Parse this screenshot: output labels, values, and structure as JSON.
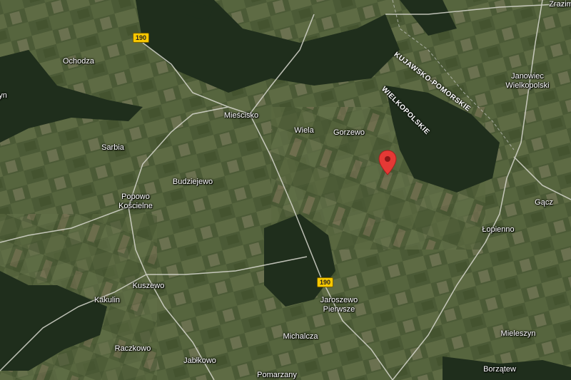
{
  "map": {
    "type": "satellite",
    "road_shields": [
      {
        "id": "r1",
        "label": "190"
      },
      {
        "id": "r2",
        "label": "190"
      }
    ],
    "region_labels": [
      "KUJAWSKO-POMORSKIE",
      "WIELKOPOLSKIE"
    ],
    "places": {
      "zrazim": "Zrazim",
      "ochodza": "Ochodza",
      "yn": "yn",
      "miescisko": "Mieścisko",
      "wiela": "Wiela",
      "gorzewo": "Gorzewo",
      "janowiec": "Janowiec\nWielkopolski",
      "sarbia": "Sarbia",
      "budziejewo": "Budziejewo",
      "popowo": "Popowo\nKościelne",
      "gacz": "Gącz",
      "lopienno": "Łopienno",
      "kuszewo": "Kuszewo",
      "kakulin": "Kakulin",
      "jaroszewo": "Jaroszewo\nPierwsze",
      "michalcza": "Michalcza",
      "raczkowo": "Raczkowo",
      "mieleszyn": "Mieleszyn",
      "jablkowo": "Jabłkowo",
      "pomarzany": "Pomarzany",
      "borzatew": "Borzątew"
    },
    "marker": {
      "icon": "map-pin-icon",
      "color": "#e53935"
    },
    "colors": {
      "field_base": "#4b5a36",
      "forest": "#1f2e1c",
      "road": "#d9d9d0"
    }
  }
}
